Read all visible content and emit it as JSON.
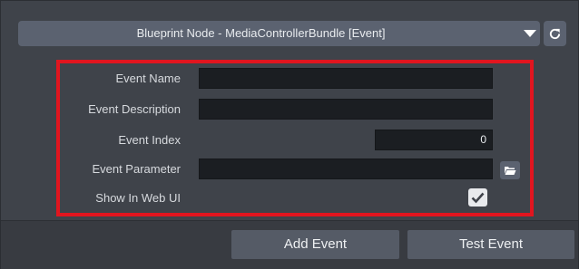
{
  "header": {
    "title": "Blueprint Node - MediaControllerBundle [Event]",
    "dropdown_icon": "triangle-down-icon",
    "refresh_icon": "refresh-icon"
  },
  "form": {
    "event_name": {
      "label": "Event Name",
      "value": ""
    },
    "event_description": {
      "label": "Event Description",
      "value": ""
    },
    "event_index": {
      "label": "Event Index",
      "value": "0"
    },
    "event_parameter": {
      "label": "Event Parameter",
      "value": "",
      "browse_icon": "folder-icon"
    },
    "show_in_web_ui": {
      "label": "Show In Web UI",
      "checked": true
    }
  },
  "highlight_color": "#e1151f",
  "buttons": {
    "add_event": "Add Event",
    "test_event": "Test Event"
  }
}
